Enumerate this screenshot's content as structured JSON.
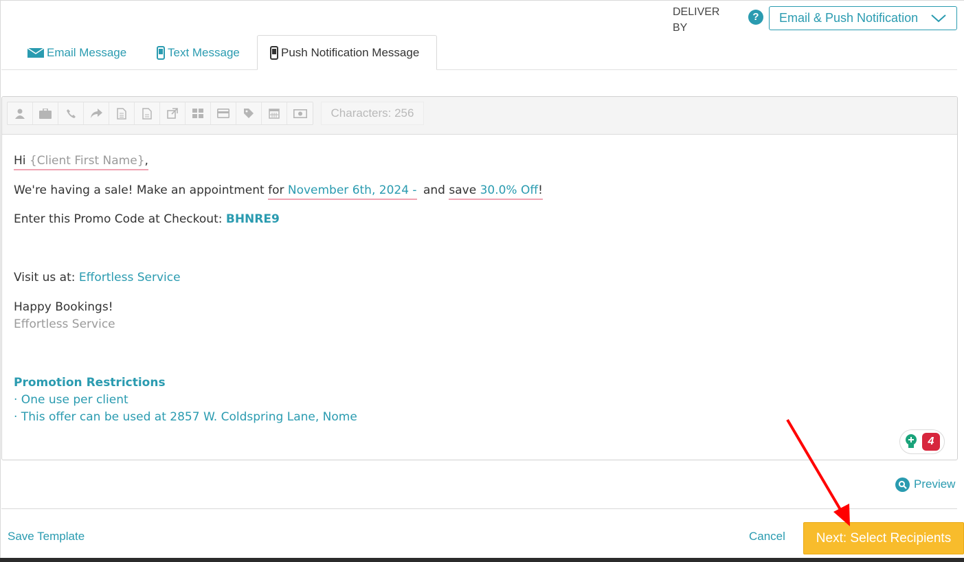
{
  "deliver": {
    "label_line1": "DELIVER",
    "label_line2": "BY",
    "selected": "Email & Push Notification"
  },
  "tabs": [
    {
      "label": "Email Message",
      "icon": "envelope-icon",
      "active": false
    },
    {
      "label": "Text Message",
      "icon": "mobile-phone-icon",
      "active": false
    },
    {
      "label": "Push Notification Message",
      "icon": "mobile-phone-icon",
      "active": true
    }
  ],
  "toolbar": {
    "icons": [
      "user-icon",
      "briefcase-icon",
      "phone-icon",
      "share-icon",
      "document-icon",
      "document-alt-icon",
      "external-link-icon",
      "grid-icon",
      "credit-card-icon",
      "tag-icon",
      "calendar-icon",
      "money-icon"
    ],
    "characters_label": "Characters: 256"
  },
  "message": {
    "greeting_prefix": "Hi",
    "client_placeholder": "{Client First Name}",
    "greeting_suffix": ",",
    "sale_prefix": "We're having a sale! Make an appointment",
    "sale_for": "for",
    "sale_date": "November 6th, 2024 -",
    "sale_and": "and",
    "sale_save": "save",
    "sale_discount": "30.0% Off",
    "sale_suffix": "!",
    "promo_prefix": "Enter this Promo Code at Checkout:",
    "promo_code": "BHNRE9",
    "visit_prefix": "Visit us at:",
    "visit_link": "Effortless Service",
    "signoff": "Happy Bookings!",
    "signature": "Effortless Service",
    "restrictions_title": "Promotion Restrictions",
    "restriction_1": "· One use per client",
    "restriction_2": "· This offer can be used at 2857 W. Coldspring Lane, Nome"
  },
  "grammar_badge": {
    "count": "4"
  },
  "preview_label": "Preview",
  "footer": {
    "save_template": "Save Template",
    "cancel": "Cancel",
    "next": "Next: Select Recipients"
  },
  "colors": {
    "accent": "#2a9bb0",
    "next_button": "#f8bc2c",
    "badge": "#d7263d",
    "annotation_arrow": "#ff0000"
  }
}
